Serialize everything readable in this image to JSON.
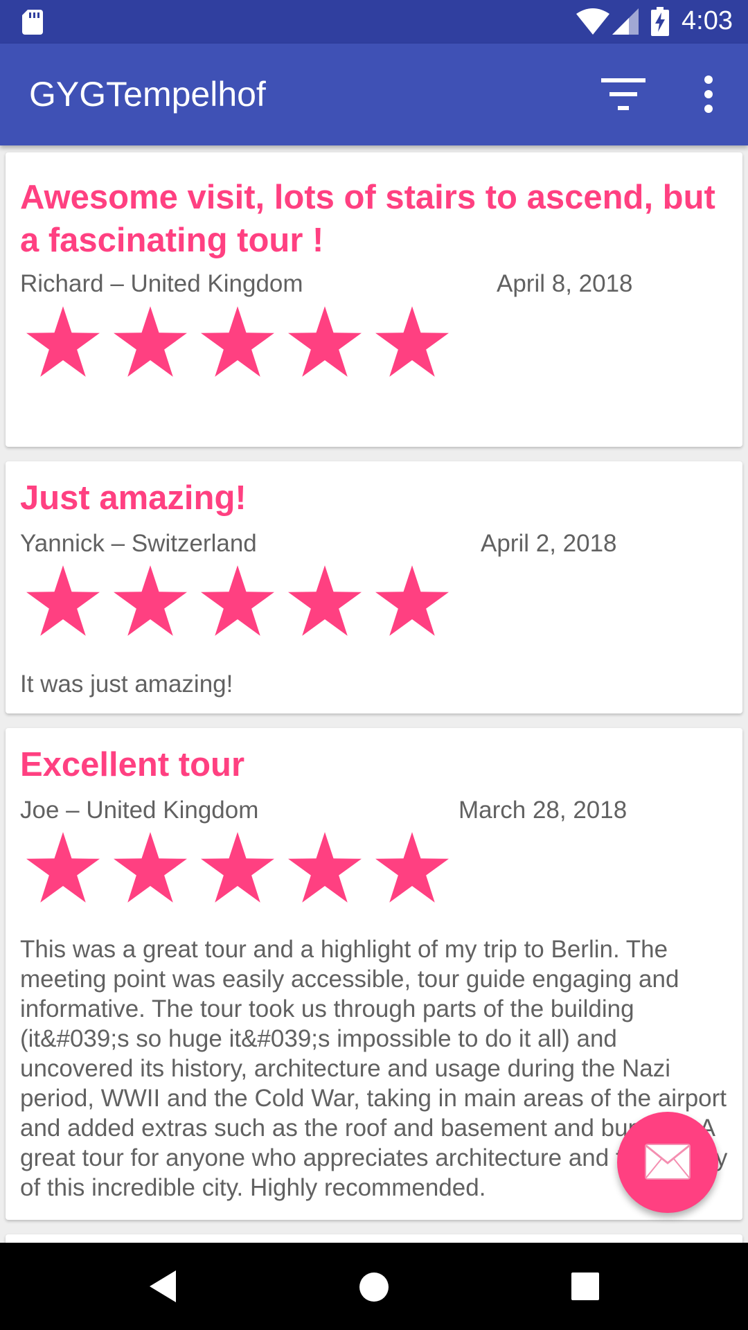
{
  "status_bar": {
    "time": "4:03",
    "icons": [
      "sd-card-icon",
      "wifi-icon",
      "cell-signal-icon",
      "battery-charging-icon"
    ]
  },
  "app_bar": {
    "title": "GYGTempelhof",
    "actions": [
      "filter-icon",
      "more-vert-icon"
    ]
  },
  "reviews": [
    {
      "title": "Awesome visit, lots of stairs to ascend, but a fascinating tour !",
      "author": "Richard – United Kingdom",
      "date": "April 8, 2018",
      "rating": 5,
      "body": ""
    },
    {
      "title": "Just amazing!",
      "author": "Yannick – Switzerland",
      "date": "April 2, 2018",
      "rating": 5,
      "body": "It was just amazing!"
    },
    {
      "title": "Excellent tour",
      "author": "Joe – United Kingdom",
      "date": "March 28, 2018",
      "rating": 5,
      "body": "This was a great tour and a highlight of my trip to Berlin. The meeting point was easily accessible, tour guide engaging and informative. The tour took us through parts of the building (it&#039;s so huge it&#039;s impossible to do it all) and uncovered its history, architecture and usage during the Nazi period, WWII and the Cold War, taking in main areas of the airport and added extras such as the roof and basement and bunkers. A great tour for anyone who appreciates architecture and the history of this incredible city. Highly recommended."
    }
  ],
  "fab": {
    "icon": "mail-icon"
  },
  "nav_bar": {
    "icons": [
      "back-icon",
      "home-icon",
      "recents-icon"
    ]
  },
  "colors": {
    "status_bar": "#303f9f",
    "app_bar": "#3f51b5",
    "accent": "#ff4081",
    "secondary_text": "#616161",
    "background": "#eeeeee"
  }
}
